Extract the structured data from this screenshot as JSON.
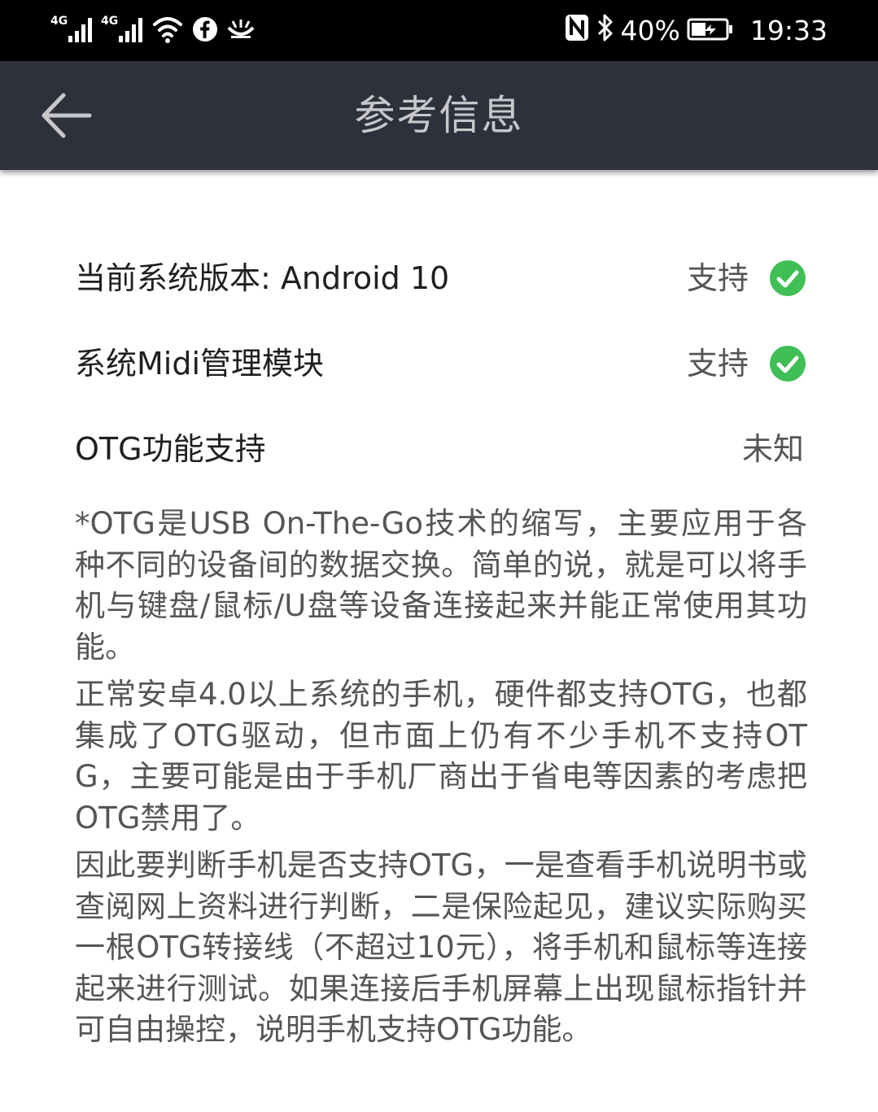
{
  "status_bar": {
    "signal1_label": "4G",
    "signal2_label": "4G",
    "icons": [
      "signal-icon",
      "signal-icon",
      "wifi-icon",
      "facebook-icon",
      "app-notification-icon",
      "nfc-icon",
      "bluetooth-icon",
      "battery-icon"
    ],
    "battery": "40%",
    "time": "19:33"
  },
  "toolbar": {
    "back_icon": "arrow-left-icon",
    "title": "参考信息"
  },
  "checks": [
    {
      "label": "当前系统版本: Android 10",
      "status": "支持",
      "icon": "check-circle-icon",
      "icon_color": "#3fbf55"
    },
    {
      "label": "系统Midi管理模块",
      "status": "支持",
      "icon": "check-circle-icon",
      "icon_color": "#3fbf55"
    },
    {
      "label": "OTG功能支持",
      "status": "未知"
    }
  ],
  "notes": [
    "*OTG是USB On-The-Go技术的缩写，主要应用于各种不同的设备间的数据交换。简单的说，就是可以将手机与键盘/鼠标/U盘等设备连接起来并能正常使用其功能。",
    "正常安卓4.0以上系统的手机，硬件都支持OTG，也都集成了OTG驱动，但市面上仍有不少手机不支持OTG，主要可能是由于手机厂商出于省电等因素的考虑把OTG禁用了。",
    "因此要判断手机是否支持OTG，一是查看手机说明书或查阅网上资料进行判断，二是保险起见，建议实际购买一根OTG转接线（不超过10元），将手机和鼠标等连接起来进行测试。如果连接后手机屏幕上出现鼠标指针并可自由操控，说明手机支持OTG功能。"
  ],
  "colors": {
    "status_bar_bg": "#000000",
    "toolbar_bg": "#2d313b",
    "title_text": "#c8c8cc",
    "label_text": "#1f1f1f",
    "secondary_text": "#555555",
    "check_green": "#3fbf55"
  }
}
